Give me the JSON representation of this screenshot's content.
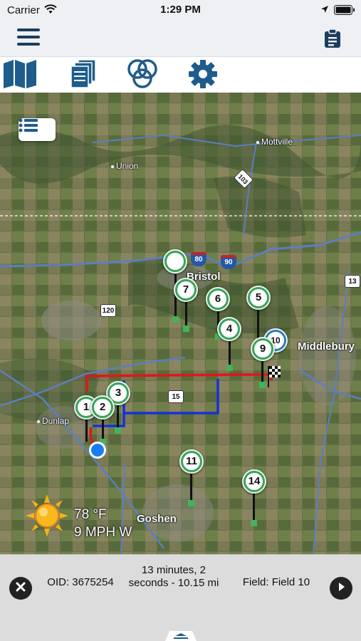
{
  "status_bar": {
    "carrier": "Carrier",
    "time": "1:29 PM"
  },
  "tabs": [
    {
      "icon": "map-icon"
    },
    {
      "icon": "documents-icon"
    },
    {
      "icon": "rings-icon"
    },
    {
      "icon": "gear-icon"
    }
  ],
  "map": {
    "places": {
      "mottville": "Mottville",
      "union": "Union",
      "bristol": "Bristol",
      "middlebury": "Middlebury",
      "dunlap": "Dunlap",
      "goshen": "Goshen"
    },
    "shields": {
      "i80": "80",
      "i90": "90",
      "us120": "120",
      "r103": "103",
      "r13": "13",
      "r15": "15"
    },
    "markers": [
      "1",
      "2",
      "3",
      "4",
      "5",
      "6",
      "7",
      "9",
      "10",
      "11",
      "14"
    ]
  },
  "weather": {
    "temperature": "78 °F",
    "wind": "9 MPH W"
  },
  "info": {
    "oid": "OID: 3675254",
    "duration": "13 minutes, 2 seconds - 10.15 mi",
    "field": "Field: Field 10"
  },
  "colors": {
    "nav_icon": "#1c3d5e",
    "tab_icon": "#1f5c8c",
    "marker_green": "#3aa35a",
    "route_red": "#e0161c",
    "route_blue": "#1432d6",
    "info_bar": "#dcdcdc"
  }
}
